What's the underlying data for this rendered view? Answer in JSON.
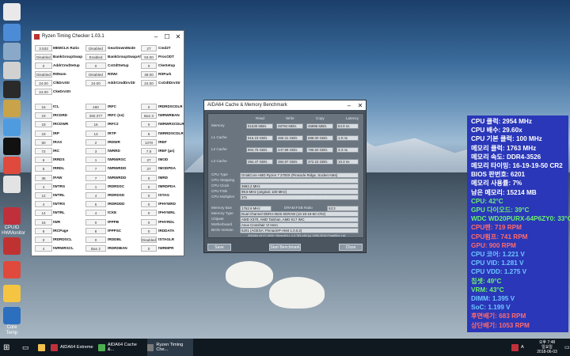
{
  "desktop_icons": [
    {
      "label": "",
      "color": "#e9e9e9"
    },
    {
      "label": "",
      "color": "#4c8bd6"
    },
    {
      "label": "",
      "color": "#8aa9c9"
    },
    {
      "label": "",
      "color": "#d1d1d1"
    },
    {
      "label": "",
      "color": "#2a2a2a"
    },
    {
      "label": "",
      "color": "#c8a34a"
    },
    {
      "label": "",
      "color": "#4f9be0"
    },
    {
      "label": "",
      "color": "#111"
    },
    {
      "label": "",
      "color": "#e04a3c"
    },
    {
      "label": "",
      "color": "#e3e3e3"
    },
    {
      "label": "CPUID HWMonitor",
      "color": "#c0303a"
    },
    {
      "label": "",
      "color": "#c03232"
    },
    {
      "label": "",
      "color": "#e04a3c"
    },
    {
      "label": "",
      "color": "#f5c542"
    },
    {
      "label": "Core Temp",
      "color": "#2c6fbf"
    }
  ],
  "rtc": {
    "title": "Ryzen Timing Checker 1.03.1",
    "top": [
      [
        "3.533",
        "MEMCLK Ratio",
        "Disabled",
        "GearDownMode",
        "2T",
        "Cmd2T"
      ],
      [
        "Disabled",
        "BankGroupSwap",
        "Enabled",
        "BankGroupSwapAlt",
        "53.00",
        "ProcODT"
      ],
      [
        "0",
        "AddrCmdSetup",
        "0",
        "CsOdtSetup",
        "0",
        "CkeSetup"
      ],
      [
        "Disabled",
        "RttNom",
        "Disabled",
        "RttWr",
        "48.00",
        "RttPark"
      ],
      [
        "24.00",
        "ClkDrvStr",
        "24.00",
        "AddrCmdDrvStr",
        "24.00",
        "CsOdtDrvStr"
      ],
      [
        "24.00",
        "CkeDrvStr",
        "",
        "",
        "",
        ""
      ]
    ],
    "timings": [
      [
        "16",
        "tCL",
        "460",
        "tRFC",
        "0",
        "tRDRDSCDLR"
      ],
      [
        "19",
        "tRCDRD",
        "260.377",
        "tRFC (ns)",
        "Ban 3",
        "tWRWRBAN"
      ],
      [
        "19",
        "tRCDWR",
        "16",
        "tRFC2",
        "0",
        "tWRWRSCDLR"
      ],
      [
        "19",
        "tRP",
        "13",
        "tRTP",
        "8",
        "tWRRDSCDLR"
      ],
      [
        "50",
        "tRAS",
        "2",
        "tRDWR",
        "1370",
        "tREF"
      ],
      [
        "72",
        "tRC",
        "3",
        "tWRRD",
        "7.8",
        "tREF (µs)"
      ],
      [
        "6",
        "tRRDS",
        "1",
        "tWRWRSC",
        "27",
        "tMOD"
      ],
      [
        "8",
        "tRRDL",
        "7",
        "tWRWRDD",
        "27",
        "tMODPDA"
      ],
      [
        "36",
        "tFAW",
        "7",
        "tWRWRDD",
        "0",
        "tMRD"
      ],
      [
        "4",
        "tWTRS",
        "1",
        "tRDRDSC",
        "0",
        "tMRDPDA"
      ],
      [
        "12",
        "tWTRL",
        "4",
        "tRDRDSD",
        "0",
        "tSTAG"
      ],
      [
        "4",
        "tWTRS",
        "5",
        "tRDRDDD",
        "0",
        "tPHYWRD"
      ],
      [
        "14",
        "tWTRL",
        "4",
        "tCKE",
        "0",
        "tPHYWRL"
      ],
      [
        "16",
        "tWR",
        "0",
        "tPPPB",
        "0",
        "tPHYRDL"
      ],
      [
        "8",
        "tRCPage",
        "8",
        "tPPPSC",
        "0",
        "tRDDATA"
      ],
      [
        "0",
        "tRDRDSCL",
        "0",
        "tRDDBL",
        "Disabled",
        "tSTAGLR"
      ],
      [
        "4",
        "tWRWRSCL",
        "Ban 2",
        "tRDRDBAN",
        "0",
        "tWRMPR"
      ]
    ]
  },
  "aida": {
    "title": "AIDA64 Cache & Memory Benchmark",
    "col_headers": [
      "Read",
      "Write",
      "Copy",
      "Latency"
    ],
    "bench": [
      {
        "label": "Memory",
        "vals": [
          "51530 MB/s",
          "49794 MB/s",
          "45995 MB/s",
          "64.9 ns"
        ]
      },
      {
        "label": "L1 Cache",
        "vals": [
          "916.23 GB/s",
          "460.31 GB/s",
          "688.00 GB/s",
          "1.0 ns"
        ]
      },
      {
        "label": "L2 Cache",
        "vals": [
          "904.75 GB/s",
          "447.89 GB/s",
          "785.50 GB/s",
          "3.3 ns"
        ]
      },
      {
        "label": "L3 Cache",
        "vals": [
          "394.47 GB/s",
          "384.97 GB/s",
          "372.22 GB/s",
          "10.3 ns"
        ]
      }
    ],
    "info": [
      {
        "label": "CPU Type",
        "val": "OctalCore AMD Ryzen 7 2700X (Pinnacle Ridge, Socket AM4)"
      },
      {
        "label": "CPU Stepping",
        "val": ""
      },
      {
        "label": "CPU Clock",
        "val": "3692.2 MHz"
      },
      {
        "label": "CPU FSB",
        "val": "99.8 MHz (original: 100 MHz)"
      },
      {
        "label": "CPU Multiplier",
        "val": "37x"
      }
    ],
    "nb_label": "North Bridge Clock",
    "info2": [
      {
        "label": "Memory Bus",
        "val": "1762.9 MHz"
      },
      {
        "label": "Memory Type",
        "val": "Dual Channel DDR4-3526 SDRAM (16-19-19-50 CR2)"
      },
      {
        "label": "Chipset",
        "val": "AMD X370, AMD Taishan, AMD K17 IMC"
      },
      {
        "label": "Motherboard",
        "val": "Asus Crosshair VI Hero"
      },
      {
        "label": "BIOS Version",
        "val": "6201 (AGESA: PinnacleP-AM4 1.0.0.2)"
      }
    ],
    "dram_ratio_label": "DRAM:FSB Ratio",
    "dram_ratio": "53:3",
    "footer": "AIDA64 v5.97.4600 / BenchDLL 4.3.783-x64  (c) 1995-2018 FinalWire Ltd.",
    "buttons": {
      "save": "Save",
      "start": "Start Benchmark",
      "close": "Close"
    }
  },
  "osd": [
    {
      "text": "CPU 클럭: 2954 MHz",
      "color": "#ffffff"
    },
    {
      "text": "CPU 배수: 29.60x",
      "color": "#ffffff"
    },
    {
      "text": "CPU 기본 클럭: 100 MHz",
      "color": "#ffffff"
    },
    {
      "text": "메모리 클럭: 1763 MHz",
      "color": "#ffffff"
    },
    {
      "text": "메모리 속도: DDR4-3526",
      "color": "#ffffff"
    },
    {
      "text": "메모리 타이밍: 16-19-19-50 CR2",
      "color": "#ffffff"
    },
    {
      "text": "BIOS 판번호: 6201",
      "color": "#ffffff"
    },
    {
      "text": "메모리 사용률: 7%",
      "color": "#ffffff"
    },
    {
      "text": "남은 메모리: 15214 MB",
      "color": "#ffffff"
    },
    {
      "text": "CPU: 42°C",
      "color": "#6df06d"
    },
    {
      "text": "GPU 다이오드: 39°C",
      "color": "#6df06d"
    },
    {
      "text": "WDC WD20PURX-64P6ZY0: 33°C",
      "color": "#6df06d"
    },
    {
      "text": "CPU팬: 719 RPM",
      "color": "#ff6b6b"
    },
    {
      "text": "CPU펌프: 741 RPM",
      "color": "#ff6b6b"
    },
    {
      "text": "GPU: 900 RPM",
      "color": "#ff6b6b"
    },
    {
      "text": "CPU 코어: 1.221 V",
      "color": "#6ec6ff"
    },
    {
      "text": "CPU VID: 1.281 V",
      "color": "#6ec6ff"
    },
    {
      "text": "CPU VDD: 1.275 V",
      "color": "#6ec6ff"
    },
    {
      "text": "칩셋: 49°C",
      "color": "#6df06d"
    },
    {
      "text": "VRM: 43°C",
      "color": "#6df06d"
    },
    {
      "text": "DIMM: 1.395 V",
      "color": "#6ec6ff"
    },
    {
      "text": "SoC: 1.199 V",
      "color": "#6ec6ff"
    },
    {
      "text": "후면배기: 683 RPM",
      "color": "#ff6b6b"
    },
    {
      "text": "상단배기: 1053 RPM",
      "color": "#ff6b6b"
    }
  ],
  "taskbar": {
    "apps": [
      {
        "label": "AIDA64 Extreme",
        "color": "#c0303a"
      },
      {
        "label": "AIDA64 Cache &...",
        "color": "#4caf50"
      },
      {
        "label": "Ryzen Timing Che...",
        "color": "#7a7a7a"
      }
    ],
    "time": "오후 7:48",
    "date": "2018-06-03",
    "day": "일요일",
    "lang": "A"
  }
}
